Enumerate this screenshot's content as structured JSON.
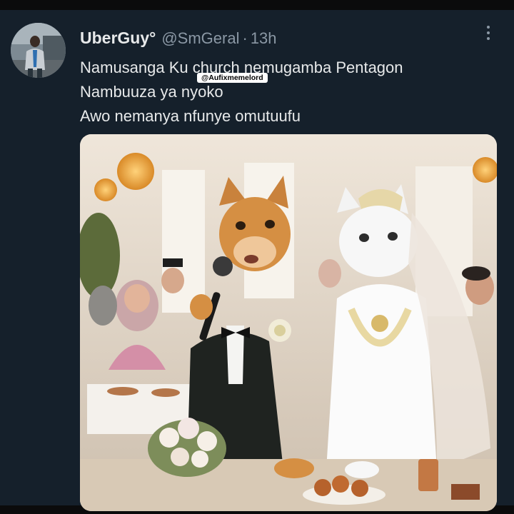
{
  "tweet": {
    "display_name": "UberGuy°",
    "handle": "@SmGeral",
    "separator": "·",
    "time": "13h",
    "text_lines": [
      "Namusanga Ku church nemugamba Pentagon",
      "Nambuuza ya nyoko",
      "Awo nemanya nfunye omutuufu"
    ],
    "watermark": "@Aufixmemelord"
  },
  "icons": {
    "more": "more-vertical-icon",
    "avatar": "user-avatar"
  },
  "colors": {
    "background": "#15202b",
    "text_primary": "#e7e9ea",
    "text_secondary": "#8b98a5"
  }
}
